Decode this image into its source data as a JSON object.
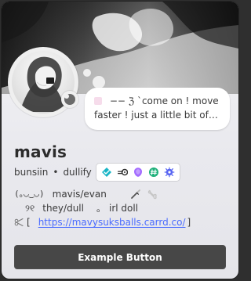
{
  "profile": {
    "display_name": "mavis",
    "username": "bunsiin",
    "separator": "•",
    "tag": "dullify",
    "status_text": "−− ℨ ˋcome on ! move faster ! just a little bit of…",
    "bio": {
      "line1_left": "(｡◡‿◡)",
      "line1_middle": "mavis/evan",
      "line2_left": "୨୧",
      "line2_middle": "they/dull",
      "line2_dot": "｡",
      "line2_right": "irl doll",
      "link_prefix": "[",
      "link_text": "https://mavysuksballs.carrd.co/",
      "link_suffix": "]"
    },
    "action_button_label": "Example Button"
  },
  "colors": {
    "button_bg": "#474747",
    "link": "#4a6cff",
    "badge_teal": "#19b5c6",
    "badge_purple": "#a36bff",
    "badge_green": "#1fb07a",
    "badge_blue": "#5865f2"
  },
  "icons": {
    "status_dot": "status-dot-icon",
    "badges": [
      "hypesquad-icon",
      "speed-icon",
      "nitro-icon",
      "hashtag-icon",
      "gear-icon"
    ],
    "bio_knife": "knife-icon",
    "bio_bone": "bone-icon",
    "link_scissors": "scissors-icon"
  }
}
